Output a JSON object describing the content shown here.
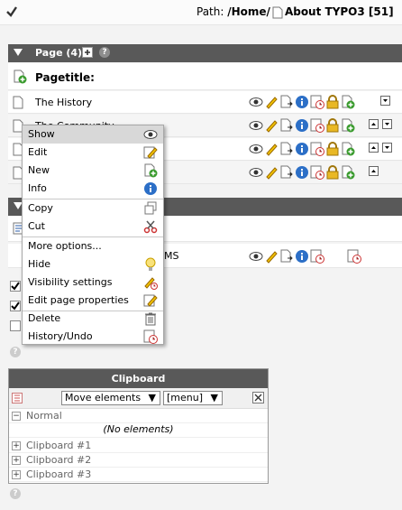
{
  "path": {
    "label": "Path:",
    "location": "/Home/",
    "page": "About TYPO3 [51]"
  },
  "page_section": {
    "title": "Page (4)",
    "pagetitle_label": "Pagetitle:",
    "rows": [
      {
        "title": "The History"
      },
      {
        "title": "The Community"
      },
      {
        "title": ""
      },
      {
        "title": ""
      }
    ]
  },
  "second_section": {
    "row_title": "MS"
  },
  "context_menu": {
    "items": [
      {
        "label": "Show",
        "icon": "eye-icon"
      },
      {
        "label": "Edit",
        "icon": "pencil-icon"
      },
      {
        "label": "New",
        "icon": "new-page-icon"
      },
      {
        "label": "Info",
        "icon": "info-icon"
      },
      {
        "label": "Copy",
        "icon": "copy-icon"
      },
      {
        "label": "Cut",
        "icon": "scissors-icon"
      },
      {
        "label": "More options...",
        "icon": ""
      },
      {
        "label": "Hide",
        "icon": "lightbulb-icon"
      },
      {
        "label": "Visibility settings",
        "icon": "visibility-icon"
      },
      {
        "label": "Edit page properties",
        "icon": "edit-properties-icon"
      },
      {
        "label": "Delete",
        "icon": "trash-icon"
      },
      {
        "label": "History/Undo",
        "icon": "history-icon"
      }
    ]
  },
  "clipboard": {
    "title": "Clipboard",
    "move_select": "Move elements",
    "menu_select": "[menu]",
    "normal_label": "Normal",
    "no_elements": "(No elements)",
    "pads": [
      "Clipboard #1",
      "Clipboard #2",
      "Clipboard #3"
    ]
  },
  "colors": {
    "header_bg": "#595959",
    "highlight": "#d8d8d8"
  }
}
